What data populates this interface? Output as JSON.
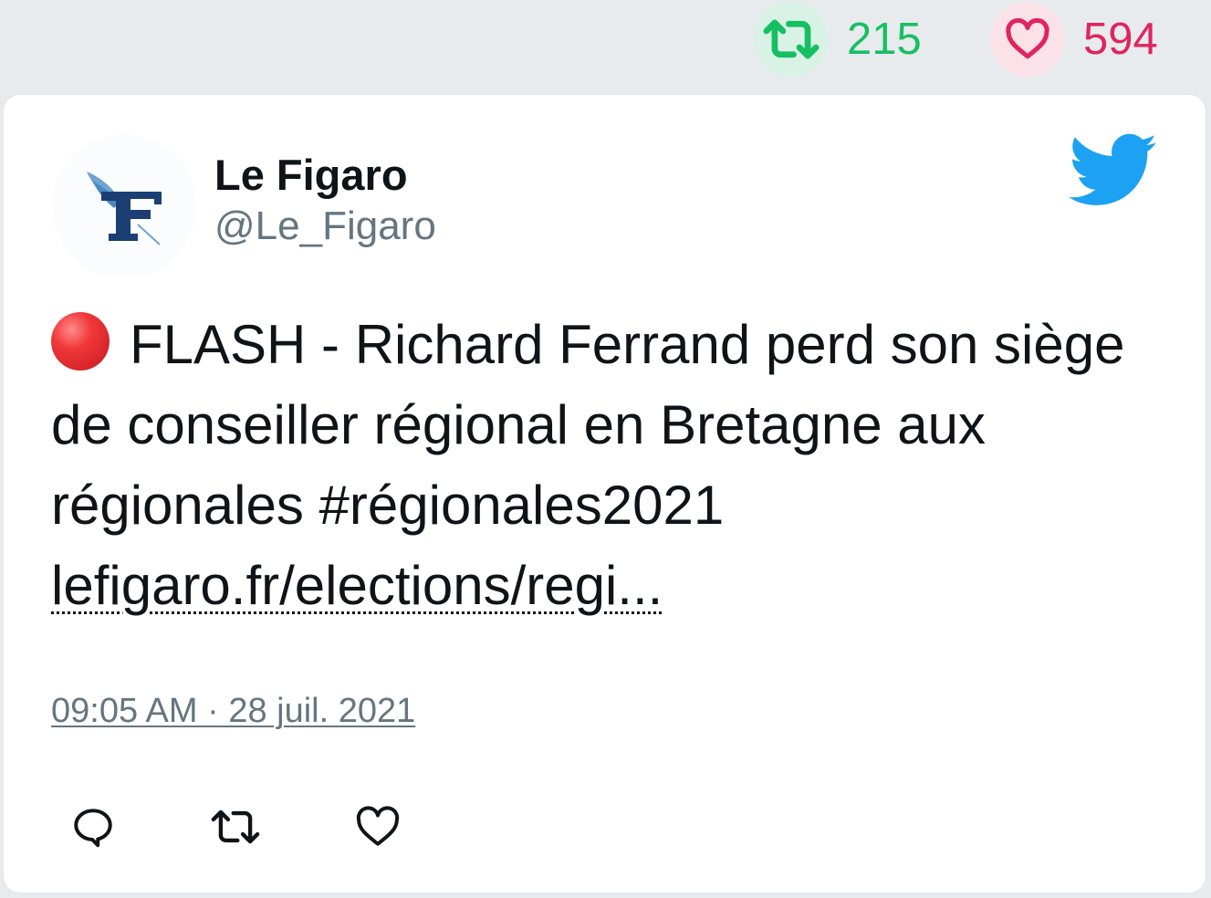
{
  "stats": {
    "retweet_icon": "retweet-icon",
    "retweet_count": "215",
    "like_icon": "heart-icon",
    "like_count": "594",
    "retweet_color": "#17bf63",
    "like_color": "#e0245e"
  },
  "tweet": {
    "author_name": "Le Figaro",
    "author_handle": "@Le_Figaro",
    "avatar_icon": "le-figaro-logo",
    "platform_icon": "twitter-bird-icon",
    "flash_icon": "red-circle-emoji",
    "text": "FLASH - Richard Ferrand perd son siège de conseiller régional en Bretagne aux régionales #régionales2021",
    "link_text": "lefigaro.fr/elections/regi...",
    "timestamp": "09:05 AM · 28 juil. 2021",
    "brand_color": "#1da1f2"
  },
  "actions": [
    {
      "icon": "reply-icon"
    },
    {
      "icon": "retweet-icon"
    },
    {
      "icon": "like-icon"
    }
  ]
}
